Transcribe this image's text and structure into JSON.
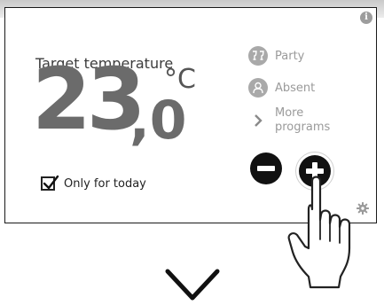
{
  "thermostat": {
    "target_label": "Target temperature",
    "temp_integer": "23",
    "temp_decimal": ",0",
    "unit": "°C",
    "only_today_label": "Only for today",
    "only_today_checked": true
  },
  "programs": {
    "party": "Party",
    "absent": "Absent",
    "more_line1": "More",
    "more_line2": "programs"
  },
  "icons": {
    "info": "info-icon",
    "party": "glasses-icon",
    "absent": "person-icon",
    "more": "chevron-right-icon",
    "minus": "minus-icon",
    "plus": "plus-icon",
    "settings": "gear-icon",
    "hand": "pointing-hand-icon",
    "transition": "chevron-down-icon"
  },
  "colors": {
    "temperature": "#6b6b6b",
    "program_text": "#9a9a9a",
    "program_icon_bg": "#a9a9a9",
    "button_bg": "#111111"
  }
}
